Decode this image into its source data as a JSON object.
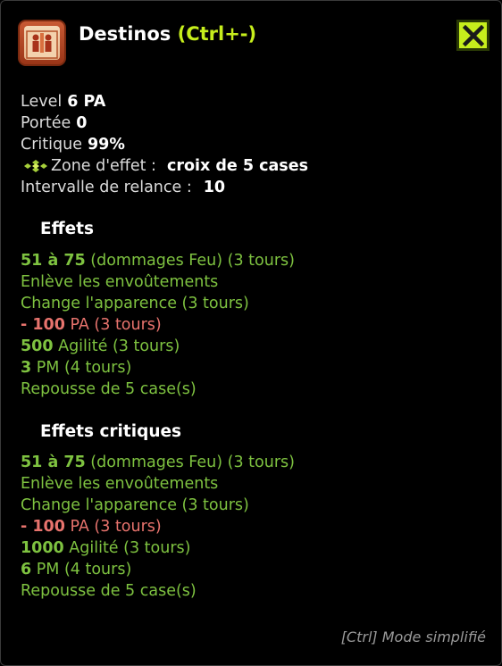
{
  "header": {
    "spell_name": "Destinos",
    "shortcut": "(Ctrl+-)",
    "spell_icon": "destinos-spell-icon",
    "close_icon": "close-x-icon"
  },
  "stats": {
    "level_label": "Level",
    "level_value": "6 PA",
    "range_label": "Portée",
    "range_value": "0",
    "critical_label": "Critique",
    "critical_value": "99%",
    "zone_label": "Zone d'effet :",
    "zone_value": "croix de 5 cases",
    "zone_icon": "cross-area-icon",
    "cooldown_label": "Intervalle de relance :",
    "cooldown_value": "10"
  },
  "effects": {
    "title": "Effets",
    "items": [
      {
        "bold": "51 à 75",
        "text": " (dommages Feu) (3 tours)"
      },
      {
        "bold": "",
        "text": "Enlève les envoûtements"
      },
      {
        "bold": "",
        "text": "Change l'apparence (3 tours)"
      },
      {
        "bold": "- 100",
        "text": " PA (3 tours)"
      },
      {
        "bold": "500",
        "text": " Agilité (3 tours)"
      },
      {
        "bold": "3",
        "text": " PM (4 tours)"
      },
      {
        "bold": "",
        "text": "Repousse de 5 case(s)"
      }
    ]
  },
  "critical_effects": {
    "title": "Effets critiques",
    "items": [
      {
        "bold": "51 à 75",
        "text": " (dommages Feu) (3 tours)"
      },
      {
        "bold": "",
        "text": "Enlève les envoûtements"
      },
      {
        "bold": "",
        "text": "Change l'apparence (3 tours)"
      },
      {
        "bold": "- 100",
        "text": " PA (3 tours)"
      },
      {
        "bold": "1000",
        "text": " Agilité (3 tours)"
      },
      {
        "bold": "6",
        "text": " PM (4 tours)"
      },
      {
        "bold": "",
        "text": "Repousse de 5 case(s)"
      }
    ]
  },
  "footer": {
    "mode_hint": "[Ctrl] Mode simplifié"
  },
  "colors": {
    "positive_effect": "#7ec240",
    "negative_effect": "#e7736d",
    "accent": "#c6ee1c"
  }
}
